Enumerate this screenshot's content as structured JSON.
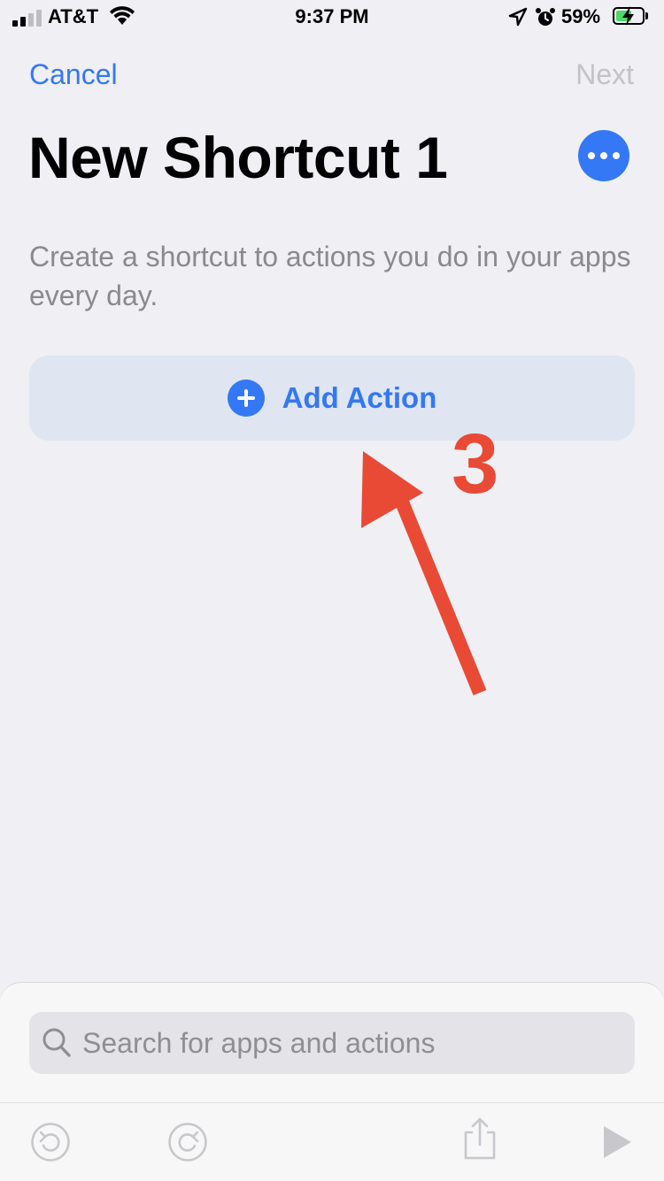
{
  "status_bar": {
    "carrier": "AT&T",
    "time": "9:37 PM",
    "battery_percent": "59%",
    "battery_level": 0.59,
    "icons": [
      "cellular-signal-icon",
      "wifi-icon",
      "location-arrow-icon",
      "alarm-icon",
      "battery-charging-icon"
    ]
  },
  "nav": {
    "cancel_label": "Cancel",
    "next_label": "Next"
  },
  "title": "New Shortcut 1",
  "description": "Create a shortcut to actions you do in your apps every day.",
  "add_action_label": "Add Action",
  "annotation": {
    "step_number": "3",
    "color": "#e94a35"
  },
  "search": {
    "placeholder": "Search for apps and actions"
  },
  "toolbar": {
    "icons": [
      "undo-icon",
      "redo-icon",
      "share-icon",
      "play-icon"
    ]
  },
  "colors": {
    "accent": "#3478f6",
    "background": "#efeff4",
    "disabled": "#c2c2c7"
  }
}
